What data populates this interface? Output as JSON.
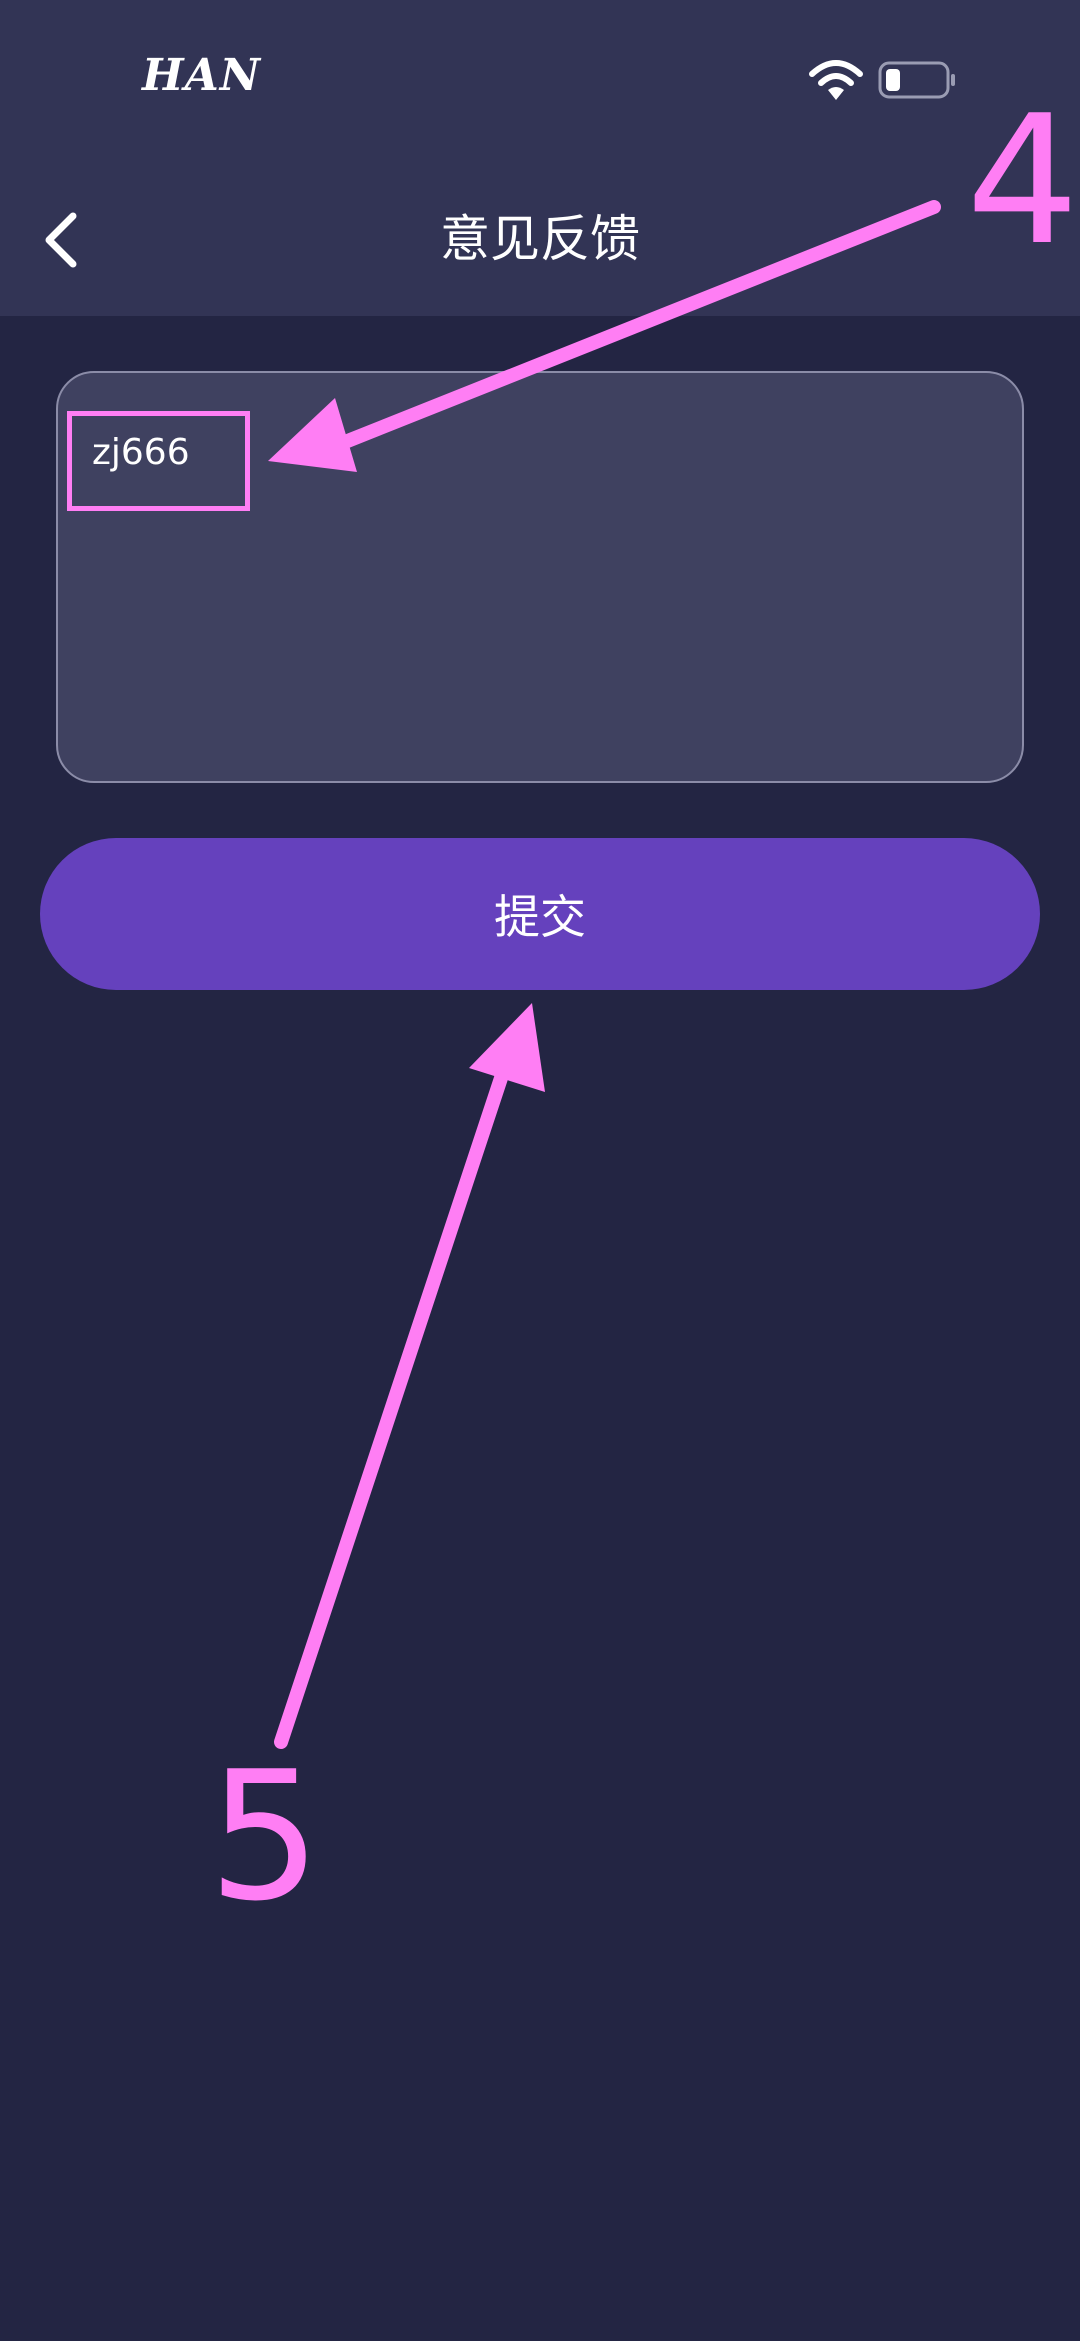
{
  "status_bar": {
    "carrier": "HAN"
  },
  "nav": {
    "title": "意见反馈"
  },
  "feedback": {
    "text": "zj666"
  },
  "submit": {
    "label": "提交"
  },
  "annotations": {
    "label_4": "4",
    "label_5": "5",
    "color": "#ff7ef4"
  },
  "colors": {
    "background": "#232543",
    "header": "#323455",
    "input_bg": "#3f4160",
    "button": "#6541bd"
  }
}
